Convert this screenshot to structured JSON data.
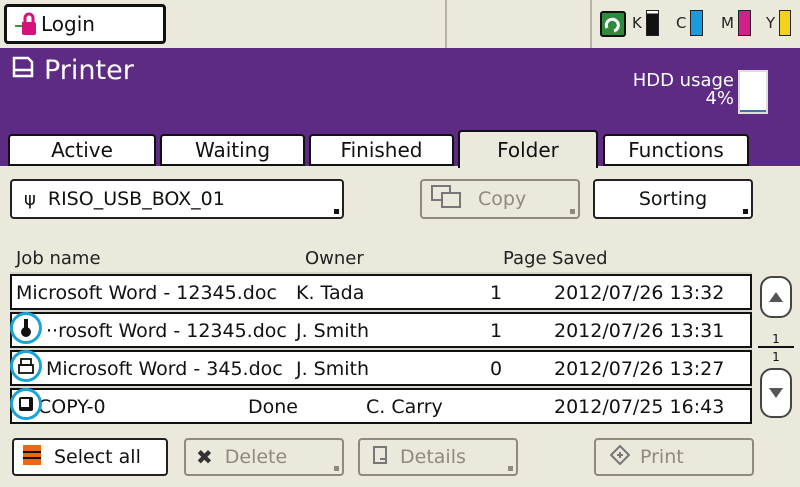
{
  "topbar": {
    "login_label": "Login",
    "ink": [
      {
        "label": "K",
        "color": "#111111"
      },
      {
        "label": "C",
        "color": "#1a9be0"
      },
      {
        "label": "M",
        "color": "#d41e8a"
      },
      {
        "label": "Y",
        "color": "#f2d21c"
      }
    ]
  },
  "header": {
    "title": "Printer",
    "hdd_label": "HDD usage",
    "hdd_value": "4%",
    "hdd_fraction": 0.04
  },
  "tabs": [
    "Active",
    "Waiting",
    "Finished",
    "Folder",
    "Functions"
  ],
  "controls": {
    "folder": "RISO_USB_BOX_01",
    "copy": "Copy",
    "sorting": "Sorting"
  },
  "columns": {
    "job": "Job name",
    "owner": "Owner",
    "page": "Page",
    "saved": "Saved"
  },
  "jobs": [
    {
      "name": "Microsoft Word - 12345.doc",
      "owner": "K. Tada",
      "page": "1",
      "saved": "2012/07/26 13:32"
    },
    {
      "name": "··rosoft Word - 12345.doc",
      "owner": "J. Smith",
      "page": "1",
      "saved": "2012/07/26 13:31"
    },
    {
      "name": "Microsoft Word - 345.doc",
      "owner": "J. Smith",
      "page": "0",
      "saved": "2012/07/26 13:27"
    },
    {
      "name": "COPY-0",
      "status": "Done",
      "owner": "C. Carry",
      "saved": "2012/07/25 16:43"
    }
  ],
  "scroll": {
    "top": "1",
    "bottom": "1"
  },
  "bottom": {
    "select_all": "Select all",
    "delete": "Delete",
    "details": "Details",
    "print": "Print"
  },
  "colors": {
    "header": "#5d2a84",
    "highlight": "#1aa3d6"
  }
}
